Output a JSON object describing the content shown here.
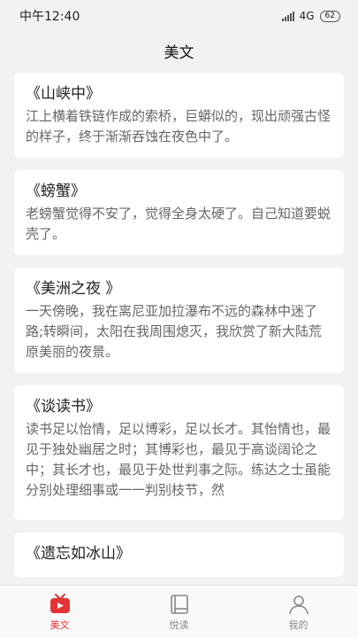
{
  "status_bar": {
    "time": "中午12:40",
    "network": "4G",
    "battery": "62"
  },
  "header": {
    "title": "美文"
  },
  "articles": [
    {
      "title": "《山峡中》",
      "excerpt": "江上横着铁链作成的索桥，巨蟒似的，现出顽强古怪的样子，终于渐渐吞蚀在夜色中了。"
    },
    {
      "title": "《螃蟹》",
      "excerpt": "老螃蟹觉得不安了，觉得全身太硬了。自己知道要蜕壳了。"
    },
    {
      "title": "《美洲之夜 》",
      "excerpt": "一天傍晚，我在离尼亚加拉瀑布不远的森林中迷了路;转瞬间，太阳在我周围熄灭，我欣赏了新大陆荒原美丽的夜景。"
    },
    {
      "title": "《谈读书》",
      "excerpt": "读书足以怡情，足以博彩，足以长才。其怡情也，最见于独处幽居之时；其博彩也，最见于高谈阔论之中；其长才也，最见于处世判事之际。练达之士虽能分别处理细事或一一判别枝节，然"
    },
    {
      "title": "《遗忘如冰山》",
      "excerpt": ""
    }
  ],
  "nav": {
    "items": [
      {
        "label": "美文",
        "icon": "tv-icon",
        "active": true
      },
      {
        "label": "悦读",
        "icon": "book-icon",
        "active": false
      },
      {
        "label": "我的",
        "icon": "user-icon",
        "active": false
      }
    ],
    "active_color": "#e33333"
  }
}
